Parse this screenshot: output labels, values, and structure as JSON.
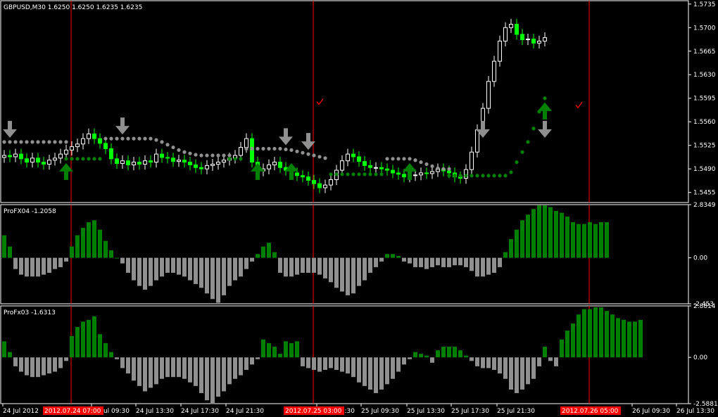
{
  "chart_data": [
    {
      "type": "candlestick",
      "title": "GBPUSD,M30  1.6250 1.6250 1.6235 1.6235",
      "ylim": [
        1.544,
        1.574
      ],
      "y_ticks": [
        "1.5735",
        "1.5700",
        "1.5665",
        "1.5630",
        "1.5595",
        "1.5560",
        "1.5525",
        "1.5490",
        "1.5455"
      ],
      "y_tick_values": [
        1.5735,
        1.57,
        1.5665,
        1.563,
        1.5595,
        1.556,
        1.5525,
        1.549,
        1.5455
      ],
      "bar_count": 97,
      "close": [
        1.551,
        1.5508,
        1.5512,
        1.5505,
        1.55,
        1.5506,
        1.55,
        1.5497,
        1.5503,
        1.5506,
        1.5512,
        1.5518,
        1.5523,
        1.5527,
        1.5535,
        1.5542,
        1.5535,
        1.5528,
        1.552,
        1.5505,
        1.5498,
        1.5502,
        1.5496,
        1.55,
        1.5497,
        1.5502,
        1.55,
        1.5512,
        1.5507,
        1.5506,
        1.5501,
        1.5503,
        1.55,
        1.5496,
        1.5492,
        1.549,
        1.5495,
        1.5497,
        1.55,
        1.5503,
        1.5506,
        1.551,
        1.5522,
        1.5535,
        1.55,
        1.5487,
        1.549,
        1.5496,
        1.55,
        1.5492,
        1.5488,
        1.5484,
        1.548,
        1.5478,
        1.5473,
        1.5468,
        1.5462,
        1.5466,
        1.5474,
        1.5488,
        1.5502,
        1.5512,
        1.5508,
        1.5501,
        1.5495,
        1.5492,
        1.5492,
        1.549,
        1.5488,
        1.5484,
        1.5482,
        1.5478,
        1.548,
        1.5481,
        1.5484,
        1.5483,
        1.5486,
        1.549,
        1.5487,
        1.5484,
        1.5478,
        1.5476,
        1.5489,
        1.5515,
        1.5548,
        1.558,
        1.562,
        1.565,
        1.568,
        1.57,
        1.5705,
        1.569,
        1.5682,
        1.5683,
        1.5677,
        1.568,
        1.5685
      ],
      "stop_line_grey": [
        1.553,
        1.553,
        1.553,
        1.553,
        1.553,
        1.553,
        1.553,
        1.553,
        1.553,
        1.553,
        1.553,
        1.553,
        null,
        null,
        null,
        null,
        null,
        null,
        1.5535,
        1.5535,
        1.5535,
        1.5535,
        1.5535,
        1.5535,
        1.5535,
        1.5535,
        1.5535,
        1.5533,
        1.553,
        1.5526,
        1.5522,
        1.5518,
        1.5515,
        1.5513,
        1.5511,
        1.551,
        1.551,
        1.551,
        1.551,
        1.551,
        1.551,
        null,
        null,
        1.552,
        1.552,
        1.552,
        1.552,
        1.552,
        1.552,
        1.552,
        1.5519,
        1.5518,
        1.5516,
        1.5514,
        1.5512,
        1.551,
        1.5508,
        1.5506,
        null,
        null,
        null,
        null,
        null,
        null,
        null,
        null,
        null,
        null,
        1.5505,
        1.5505,
        1.5505,
        1.5505,
        1.5505,
        1.5503,
        1.55,
        1.5497,
        1.5494,
        1.5491,
        1.549,
        1.549,
        null,
        null,
        null,
        null,
        null,
        null,
        null,
        null,
        null,
        null,
        null,
        null,
        null,
        null,
        null,
        null,
        null
      ],
      "stop_line_green": [
        null,
        null,
        null,
        null,
        null,
        null,
        null,
        null,
        null,
        null,
        null,
        1.5505,
        1.5505,
        1.5505,
        1.5505,
        1.5505,
        1.5505,
        1.5505,
        null,
        null,
        null,
        null,
        null,
        null,
        null,
        null,
        null,
        null,
        null,
        null,
        null,
        null,
        null,
        null,
        null,
        null,
        null,
        null,
        null,
        null,
        1.5505,
        1.5505,
        1.5505,
        null,
        null,
        null,
        null,
        null,
        null,
        null,
        null,
        null,
        null,
        null,
        null,
        null,
        null,
        null,
        1.5482,
        1.5482,
        1.5482,
        1.5482,
        1.5482,
        1.5482,
        1.5482,
        1.5482,
        1.5482,
        1.5482,
        null,
        null,
        null,
        null,
        null,
        null,
        null,
        null,
        null,
        null,
        null,
        1.548,
        1.548,
        1.548,
        1.548,
        1.548,
        1.548,
        1.548,
        1.548,
        1.548,
        1.548,
        1.548,
        1.5485,
        1.55,
        1.5515,
        1.553,
        1.555,
        1.5575,
        1.5595
      ],
      "arrows_down_grey": [
        1,
        21,
        50,
        54,
        85,
        103
      ],
      "arrows_up_green": [
        11,
        45,
        51,
        72,
        100,
        103
      ],
      "check_marks": [
        {
          "bar": 56,
          "price": 1.559
        },
        {
          "bar": 102,
          "price": 1.5585
        }
      ],
      "vlines_bars": [
        12,
        55,
        104
      ]
    },
    {
      "type": "bar",
      "title": "ProFX04 -1.2058",
      "ylim": [
        -2.453,
        2.8349
      ],
      "y_ticks": [
        "2.8349",
        "0.00",
        "-2.453"
      ],
      "y_tick_values": [
        2.8349,
        0.0,
        -2.453
      ],
      "values": [
        1.2,
        0.6,
        -0.6,
        -0.9,
        -1.0,
        -1.0,
        -1.0,
        -0.9,
        -0.8,
        -0.6,
        -0.5,
        -0.2,
        0.6,
        1.2,
        1.6,
        1.9,
        2.0,
        1.5,
        0.9,
        0.4,
        0.0,
        -0.3,
        -0.8,
        -1.2,
        -1.5,
        -1.7,
        -1.5,
        -1.2,
        -1.0,
        -0.8,
        -0.8,
        -0.9,
        -1.0,
        -1.2,
        -1.4,
        -1.6,
        -1.9,
        -2.2,
        -2.4,
        -2.0,
        -1.5,
        -1.2,
        -1.0,
        -0.6,
        -0.2,
        0.2,
        0.6,
        0.8,
        0.3,
        -0.8,
        -1.0,
        -1.0,
        -0.9,
        -0.8,
        -0.8,
        -0.8,
        -0.9,
        -1.1,
        -1.3,
        -1.6,
        -1.8,
        -2.0,
        -1.9,
        -1.5,
        -1.2,
        -0.8,
        -0.5,
        -0.2,
        0.2,
        0.2,
        0.1,
        -0.2,
        -0.3,
        -0.5,
        -0.5,
        -0.6,
        -0.5,
        -0.4,
        -0.5,
        -0.5,
        -0.4,
        -0.4,
        -0.5,
        -0.7,
        -1.0,
        -1.0,
        -0.9,
        -0.8,
        -0.5,
        0.3,
        1.0,
        1.5,
        2.0,
        2.3,
        2.6,
        2.8,
        2.8,
        2.7,
        2.5,
        2.4,
        2.2,
        1.9,
        1.8,
        1.8,
        1.9,
        1.8,
        1.9,
        1.9
      ],
      "vlines_bars": [
        12,
        55,
        104
      ]
    },
    {
      "type": "bar",
      "title": "ProFx03 -1.6313",
      "ylim": [
        -2.5881,
        2.8814
      ],
      "y_ticks": [
        "2.8814",
        "0.00",
        "-2.5881"
      ],
      "y_tick_values": [
        2.8814,
        0.0,
        -2.5881
      ],
      "values": [
        0.9,
        0.3,
        -0.5,
        -0.8,
        -1.0,
        -1.1,
        -1.1,
        -1.0,
        -0.9,
        -0.8,
        -0.6,
        -0.2,
        1.2,
        1.7,
        2.0,
        2.1,
        2.3,
        1.3,
        0.8,
        0.3,
        -0.1,
        -0.6,
        -0.9,
        -1.3,
        -1.6,
        -1.9,
        -1.7,
        -1.5,
        -1.2,
        -1.1,
        -1.1,
        -1.1,
        -1.2,
        -1.4,
        -1.6,
        -2.0,
        -2.4,
        -2.6,
        -2.2,
        -1.9,
        -1.5,
        -1.2,
        -1.0,
        -0.7,
        -0.4,
        -0.1,
        1.0,
        0.8,
        0.6,
        0.2,
        0.9,
        0.8,
        0.9,
        -0.5,
        -0.6,
        -0.7,
        -0.8,
        -0.7,
        -0.6,
        -0.7,
        -0.8,
        -0.9,
        -1.1,
        -1.4,
        -1.6,
        -1.8,
        -2.0,
        -1.8,
        -1.5,
        -1.2,
        -0.8,
        -0.4,
        -0.1,
        0.3,
        0.2,
        0.1,
        -0.3,
        0.4,
        0.6,
        0.6,
        0.6,
        0.4,
        0.1,
        -0.2,
        -0.5,
        -0.6,
        -0.6,
        -0.7,
        -0.9,
        -1.2,
        -1.8,
        -2.0,
        -1.8,
        -1.5,
        -1.2,
        -0.5,
        0.6,
        -0.2,
        -0.5,
        1.0,
        1.5,
        1.9,
        2.4,
        2.7,
        2.7,
        2.8,
        2.8,
        2.6,
        2.4,
        2.2,
        2.1,
        2.0,
        2.0,
        2.1
      ],
      "vlines_bars": [
        12,
        55,
        104
      ]
    }
  ],
  "x_axis": {
    "labels": [
      "24 Jul 2012",
      "24 Jul 09:30",
      "24 Jul 13:30",
      "24 Jul 17:30",
      "24 Jul 21:30",
      "25 Jul 05:30",
      "25 Jul 09:30",
      "25 Jul 13:30",
      "25 Jul 17:30",
      "25 Jul 21:30",
      "26 Jul 09:30",
      "26 Jul 13:30"
    ],
    "highlights": [
      "2012.07.24 07:00",
      "2012.07.25 03:00",
      "2012.07.26 05:00"
    ]
  },
  "colors": {
    "background": "#000000",
    "frame": "#ffffff",
    "bull_candle": "#ffffff",
    "bear_candle": "#00ff00",
    "grey": "#909090",
    "green": "#008000",
    "vline": "#ff0000",
    "check": "#ff0000"
  }
}
